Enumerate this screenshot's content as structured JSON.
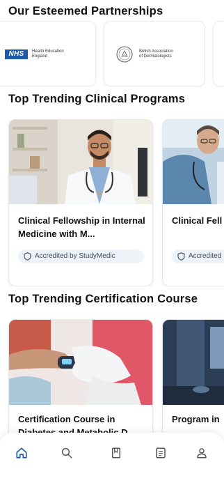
{
  "sections": {
    "partnerships_title": "Our Esteemed Partnerships",
    "programs_title": "Top Trending Clinical Programs",
    "certification_title": "Top Trending Certification Course"
  },
  "partners": [
    {
      "logo": "NHS",
      "name_line1": "Health Education",
      "name_line2": "England"
    },
    {
      "logo": "BAD",
      "name_line1": "British Association",
      "name_line2": "of Dermatologists"
    }
  ],
  "programs": [
    {
      "title": "Clinical Fellowship in Internal Medicine with M...",
      "badge": "Accredited by StudyMedic"
    },
    {
      "title": "Clinical Fell Paediatrics",
      "badge": "Accredited"
    }
  ],
  "certifications": [
    {
      "title": "Certification Course in Diabetes and Metabolic D..."
    },
    {
      "title": "Program in"
    }
  ],
  "nav": {
    "items": [
      "home-icon",
      "search-icon",
      "book-icon",
      "document-icon",
      "user-icon"
    ],
    "active_color": "#1f5aa8",
    "inactive_color": "#555555"
  }
}
